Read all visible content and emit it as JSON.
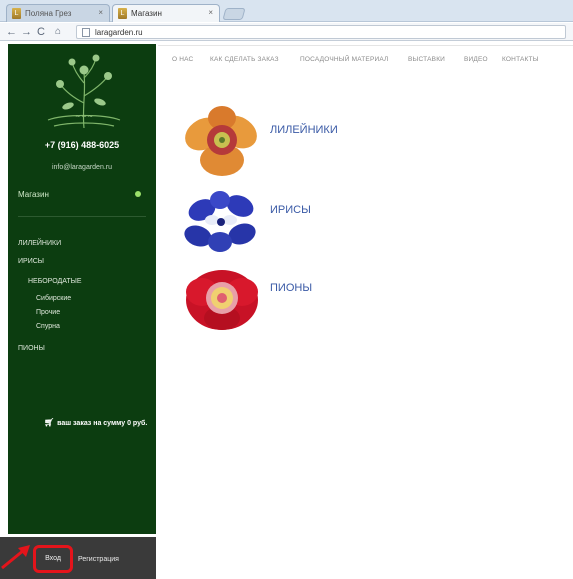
{
  "browser": {
    "tabs": [
      {
        "label": "Поляна Грез",
        "active": false
      },
      {
        "label": "Магазин",
        "active": true
      }
    ],
    "url": "laragarden.ru"
  },
  "sidebar": {
    "phone": "+7 (916) 488-6025",
    "email": "info@laragarden.ru",
    "shop_label": "Магазин",
    "categories": [
      {
        "label": "ЛИЛЕЙНИКИ"
      },
      {
        "label": "ИРИСЫ"
      },
      {
        "label": "НЕБОРОДАТЫЕ"
      },
      {
        "label": "Сибирские"
      },
      {
        "label": "Прочие"
      },
      {
        "label": "Спурна"
      },
      {
        "label": "ПИОНЫ"
      }
    ],
    "cart_text": "ваш заказ на сумму 0 руб.",
    "login_label": "Вход",
    "register_label": "Регистрация"
  },
  "topnav": {
    "items": [
      {
        "label": "О НАС"
      },
      {
        "label": "КАК СДЕЛАТЬ ЗАКАЗ"
      },
      {
        "label": "ПОСАДОЧНЫЙ МАТЕРИАЛ"
      },
      {
        "label": "ВЫСТАВКИ"
      },
      {
        "label": "ВИДЕО"
      },
      {
        "label": "КОНТАКТЫ"
      }
    ]
  },
  "products": [
    {
      "name": "ЛИЛЕЙНИКИ"
    },
    {
      "name": "ИРИСЫ"
    },
    {
      "name": "ПИОНЫ"
    }
  ],
  "colors": {
    "sidebar_bg": "#0c3d10",
    "accent_dot": "#9be06a",
    "product_link": "#3a5aa6",
    "highlight": "#e4141b"
  }
}
